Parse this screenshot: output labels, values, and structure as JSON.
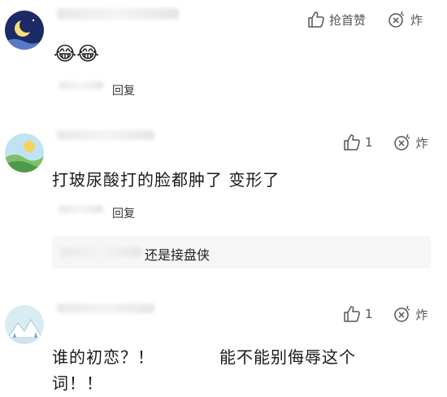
{
  "comments": [
    {
      "avatar": "moon-night-avatar",
      "like_label": "抢首赞",
      "bomb_label": "炸",
      "content": "😂😂",
      "reply_label": "回复"
    },
    {
      "avatar": "landscape-avatar",
      "like_label": "1",
      "bomb_label": "炸",
      "content": "打玻尿酸打的脸都肿了 变形了",
      "reply_label": "回复",
      "sub_reply": "还是接盘侠"
    },
    {
      "avatar": "snow-mountain-avatar",
      "like_label": "1",
      "bomb_label": "炸",
      "content_line1_a": "谁的初恋？！",
      "content_line1_b": "能不能别侮辱这个",
      "content_line2": "词！！"
    }
  ],
  "colors": {
    "text": "#1a1a1a",
    "icon": "#555555",
    "sub_bg": "#f6f6f6"
  }
}
